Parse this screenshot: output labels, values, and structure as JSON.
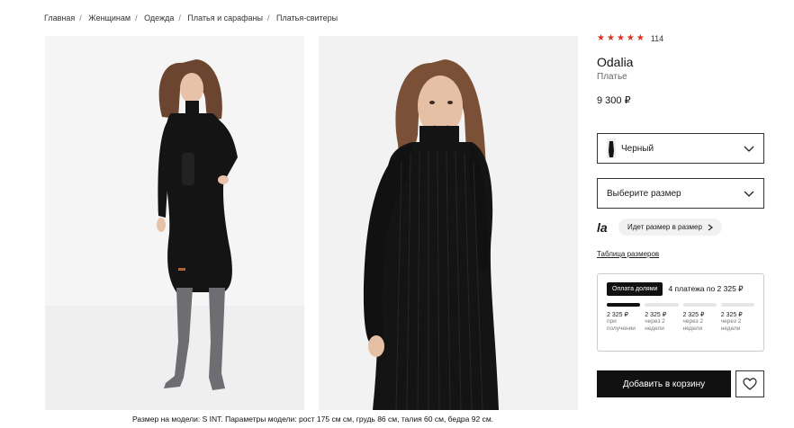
{
  "breadcrumb": [
    "Главная",
    "Женщинам",
    "Одежда",
    "Платья и сарафаны",
    "Платья-свитеры"
  ],
  "model_note": "Размер на модели: S INT. Параметры модели: рост 175 см см, грудь 86 см, талия 60 см, бедра 92 см.",
  "product": {
    "rating_count": "114",
    "brand": "Odalia",
    "type": "Платье",
    "price": "9 300 ₽"
  },
  "color_select": {
    "value": "Черный"
  },
  "size_select": {
    "placeholder": "Выберите размер"
  },
  "fit": {
    "logo": "la",
    "button": "Идет размер в размер"
  },
  "size_table_link": "Таблица размеров",
  "split": {
    "badge": "Оплата долями",
    "text": "4 платежа по 2 325 ₽",
    "payments": [
      {
        "amount": "2 325 ₽",
        "when": "при получении"
      },
      {
        "amount": "2 325 ₽",
        "when": "через 2 недели"
      },
      {
        "amount": "2 325 ₽",
        "when": "через 2 недели"
      },
      {
        "amount": "2 325 ₽",
        "when": "через 2 недели"
      }
    ]
  },
  "cart_button": "Добавить в корзину",
  "colors": {
    "star": "#d6321f",
    "dress": "#141414",
    "boots": "#6d6d72"
  }
}
